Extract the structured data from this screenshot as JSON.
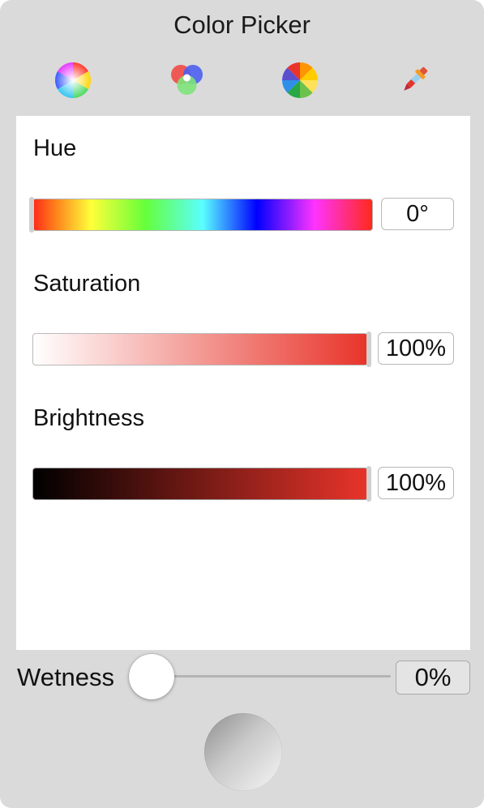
{
  "window": {
    "title": "Color Picker"
  },
  "toolbar": {
    "items": [
      {
        "icon": "color-wheel-icon"
      },
      {
        "icon": "color-sliders-icon"
      },
      {
        "icon": "color-palettes-icon"
      },
      {
        "icon": "eyedropper-icon"
      }
    ]
  },
  "sliders": {
    "hue": {
      "label": "Hue",
      "value": "0°"
    },
    "saturation": {
      "label": "Saturation",
      "value": "100%"
    },
    "brightness": {
      "label": "Brightness",
      "value": "100%"
    }
  },
  "wetness": {
    "label": "Wetness",
    "value": "0%"
  },
  "colors": {
    "current": "#E8342A",
    "window_bg": "#DADADA",
    "panel_bg": "#FFFFFF"
  }
}
